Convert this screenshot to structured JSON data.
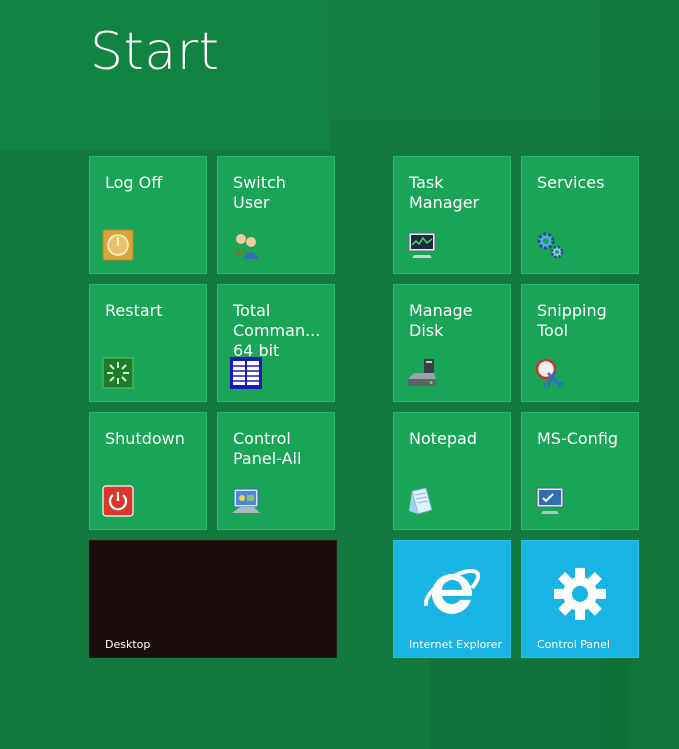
{
  "start": {
    "title": "Start"
  },
  "colors": {
    "background": "#127a3f",
    "tile_green": "#1aa457",
    "tile_blue": "#18b4e4",
    "tile_desktop": "#1b0d0e"
  },
  "tiles": [
    {
      "label": "Log Off",
      "icon": "log-off-icon"
    },
    {
      "label": "Switch User",
      "icon": "switch-user-icon"
    },
    {
      "label": "Restart",
      "icon": "restart-icon"
    },
    {
      "label": "Total\nComman...\n64 bit",
      "icon": "total-commander-icon"
    },
    {
      "label": "Shutdown",
      "icon": "shutdown-icon"
    },
    {
      "label": "Control\nPanel-All",
      "icon": "control-panel-all-icon"
    },
    {
      "label": "Desktop",
      "icon": ""
    },
    {
      "label": "Task\nManager",
      "icon": "task-manager-icon"
    },
    {
      "label": "Services",
      "icon": "services-icon"
    },
    {
      "label": "Manage\nDisk",
      "icon": "manage-disk-icon"
    },
    {
      "label": "Snipping\nTool",
      "icon": "snipping-tool-icon"
    },
    {
      "label": "Notepad",
      "icon": "notepad-icon"
    },
    {
      "label": "MS-Config",
      "icon": "ms-config-icon"
    },
    {
      "label": "Internet Explorer",
      "icon": "internet-explorer-icon"
    },
    {
      "label": "Control Panel",
      "icon": "gear-icon"
    }
  ]
}
